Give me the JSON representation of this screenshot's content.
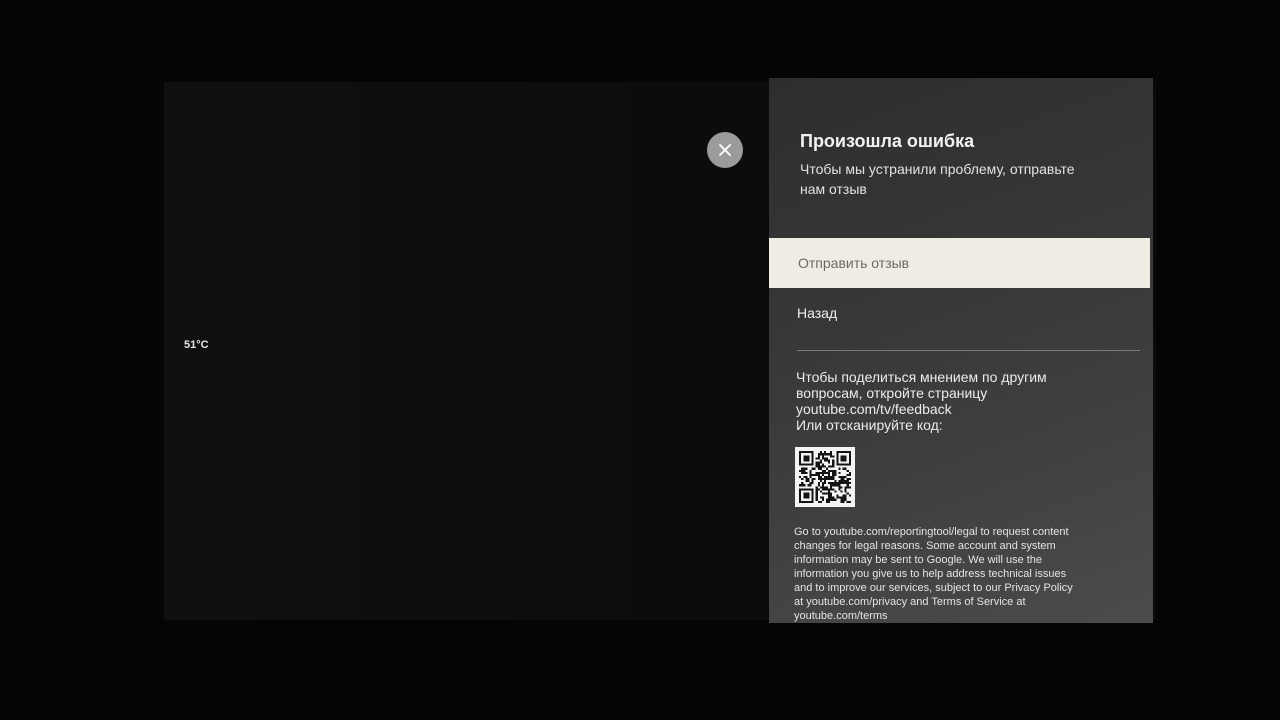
{
  "screen": {
    "temperature": "51°C"
  },
  "close_button": {
    "icon": "close-icon"
  },
  "dialog": {
    "title": "Произошла ошибка",
    "subtitle_lines": [
      "Чтобы мы устранили проблему, отправьте",
      "нам отзыв"
    ],
    "menu": [
      {
        "label": "Отправить отзыв",
        "selected": true
      },
      {
        "label": "Назад",
        "selected": false
      }
    ],
    "feedback_info": [
      "Чтобы поделиться мнением по другим",
      "вопросам, откройте страницу",
      "youtube.com/tv/feedback",
      "Или отсканируйте код:"
    ],
    "qr_icon": "qr-code",
    "legal_lines": [
      "Go to youtube.com/reportingtool/legal to request content",
      "changes for legal reasons. Some account and system",
      "information may be sent to Google. We will use the",
      "information you give us to help address technical issues",
      "and to improve our services, subject to our Privacy Policy",
      "at youtube.com/privacy and Terms of Service at",
      "youtube.com/terms"
    ]
  },
  "colors": {
    "panel_bg": "#3a3a3a",
    "selected_item_bg": "#efece3",
    "selected_item_text": "#6a6a6a",
    "close_button_bg": "#9b9b9b",
    "text": "#ececec"
  }
}
